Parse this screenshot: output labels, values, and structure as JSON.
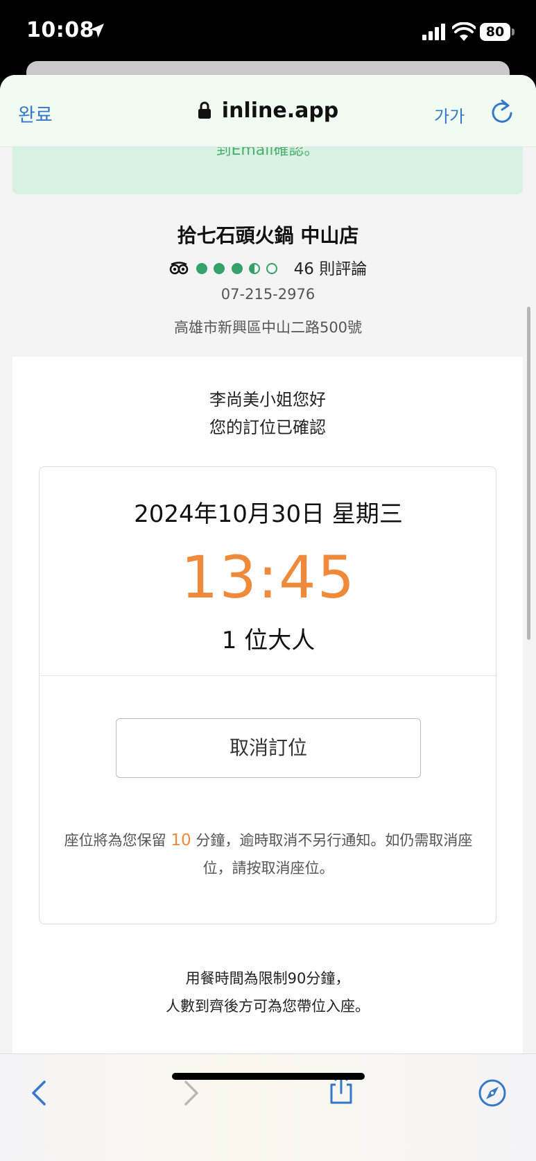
{
  "status_bar": {
    "time": "10:08",
    "battery": "80"
  },
  "browser": {
    "done_label": "완료",
    "url": "inline.app",
    "text_size_label": "가가",
    "accent_color": "#3478c8"
  },
  "banner": {
    "text": "到Email確認。"
  },
  "restaurant": {
    "name": "拾七石頭火鍋 中山店",
    "rating_bubbles": 3.5,
    "review_count": "46 則評論",
    "phone": "07-215-2976",
    "address": "高雄市新興區中山二路500號"
  },
  "reservation": {
    "greeting_line1": "李尚美小姐您好",
    "greeting_line2": "您的訂位已確認",
    "date": "2024年10月30日 星期三",
    "time": "13:45",
    "party": "1 位大人",
    "cancel_label": "取消訂位",
    "notice_part1": "座位將為您保留 ",
    "notice_minutes": "10",
    "notice_part2": " 分鐘，逾時取消不另行通知。如仍需取消座位，請按取消座位。",
    "dining_line1": "用餐時間為限制90分鐘，",
    "dining_line2": "人數到齊後方可為您帶位入座。",
    "time_color": "#ee8a3a"
  }
}
